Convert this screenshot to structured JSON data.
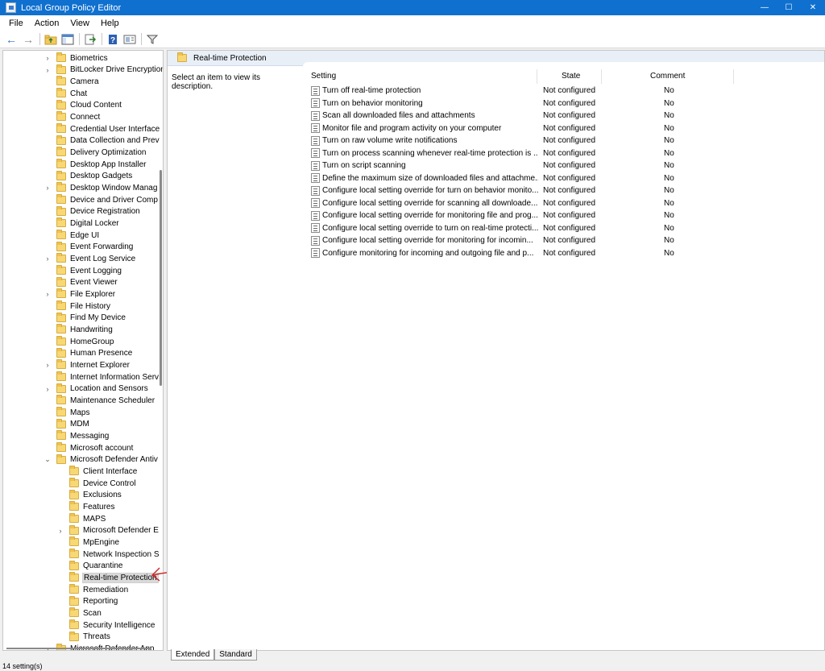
{
  "window": {
    "title": "Local Group Policy Editor",
    "min": "—",
    "max": "☐",
    "close": "✕"
  },
  "menu": [
    "File",
    "Action",
    "View",
    "Help"
  ],
  "tree": [
    {
      "label": "Biometrics",
      "expander": "›",
      "level": 1
    },
    {
      "label": "BitLocker Drive Encryption",
      "expander": "›",
      "level": 1
    },
    {
      "label": "Camera",
      "expander": "",
      "level": 1
    },
    {
      "label": "Chat",
      "expander": "",
      "level": 1
    },
    {
      "label": "Cloud Content",
      "expander": "",
      "level": 1
    },
    {
      "label": "Connect",
      "expander": "",
      "level": 1
    },
    {
      "label": "Credential User Interface",
      "expander": "",
      "level": 1
    },
    {
      "label": "Data Collection and Prev",
      "expander": "",
      "level": 1
    },
    {
      "label": "Delivery Optimization",
      "expander": "",
      "level": 1
    },
    {
      "label": "Desktop App Installer",
      "expander": "",
      "level": 1
    },
    {
      "label": "Desktop Gadgets",
      "expander": "",
      "level": 1
    },
    {
      "label": "Desktop Window Manag",
      "expander": "›",
      "level": 1
    },
    {
      "label": "Device and Driver Comp",
      "expander": "",
      "level": 1
    },
    {
      "label": "Device Registration",
      "expander": "",
      "level": 1
    },
    {
      "label": "Digital Locker",
      "expander": "",
      "level": 1
    },
    {
      "label": "Edge UI",
      "expander": "",
      "level": 1
    },
    {
      "label": "Event Forwarding",
      "expander": "",
      "level": 1
    },
    {
      "label": "Event Log Service",
      "expander": "›",
      "level": 1
    },
    {
      "label": "Event Logging",
      "expander": "",
      "level": 1
    },
    {
      "label": "Event Viewer",
      "expander": "",
      "level": 1
    },
    {
      "label": "File Explorer",
      "expander": "›",
      "level": 1
    },
    {
      "label": "File History",
      "expander": "",
      "level": 1
    },
    {
      "label": "Find My Device",
      "expander": "",
      "level": 1
    },
    {
      "label": "Handwriting",
      "expander": "",
      "level": 1
    },
    {
      "label": "HomeGroup",
      "expander": "",
      "level": 1
    },
    {
      "label": "Human Presence",
      "expander": "",
      "level": 1
    },
    {
      "label": "Internet Explorer",
      "expander": "›",
      "level": 1
    },
    {
      "label": "Internet Information Serv",
      "expander": "",
      "level": 1
    },
    {
      "label": "Location and Sensors",
      "expander": "›",
      "level": 1
    },
    {
      "label": "Maintenance Scheduler",
      "expander": "",
      "level": 1
    },
    {
      "label": "Maps",
      "expander": "",
      "level": 1
    },
    {
      "label": "MDM",
      "expander": "",
      "level": 1
    },
    {
      "label": "Messaging",
      "expander": "",
      "level": 1
    },
    {
      "label": "Microsoft account",
      "expander": "",
      "level": 1
    },
    {
      "label": "Microsoft Defender Antiv",
      "expander": "⌄",
      "level": 1
    },
    {
      "label": "Client Interface",
      "expander": "",
      "level": 2
    },
    {
      "label": "Device Control",
      "expander": "",
      "level": 2
    },
    {
      "label": "Exclusions",
      "expander": "",
      "level": 2
    },
    {
      "label": "Features",
      "expander": "",
      "level": 2
    },
    {
      "label": "MAPS",
      "expander": "",
      "level": 2
    },
    {
      "label": "Microsoft Defender E",
      "expander": "›",
      "level": 2
    },
    {
      "label": "MpEngine",
      "expander": "",
      "level": 2
    },
    {
      "label": "Network Inspection S",
      "expander": "",
      "level": 2
    },
    {
      "label": "Quarantine",
      "expander": "",
      "level": 2
    },
    {
      "label": "Real-time Protection",
      "expander": "",
      "level": 2,
      "selected": true
    },
    {
      "label": "Remediation",
      "expander": "",
      "level": 2
    },
    {
      "label": "Reporting",
      "expander": "",
      "level": 2
    },
    {
      "label": "Scan",
      "expander": "",
      "level": 2
    },
    {
      "label": "Security Intelligence",
      "expander": "",
      "level": 2
    },
    {
      "label": "Threats",
      "expander": "",
      "level": 2
    },
    {
      "label": "Microsoft Defender App",
      "expander": "›",
      "level": 1
    }
  ],
  "right": {
    "title": "Real-time Protection",
    "description": "Select an item to view its description.",
    "columns": {
      "setting": "Setting",
      "state": "State",
      "comment": "Comment"
    },
    "settings": [
      {
        "name": "Turn off real-time protection",
        "state": "Not configured",
        "comment": "No"
      },
      {
        "name": "Turn on behavior monitoring",
        "state": "Not configured",
        "comment": "No"
      },
      {
        "name": "Scan all downloaded files and attachments",
        "state": "Not configured",
        "comment": "No"
      },
      {
        "name": "Monitor file and program activity on your computer",
        "state": "Not configured",
        "comment": "No"
      },
      {
        "name": "Turn on raw volume write notifications",
        "state": "Not configured",
        "comment": "No"
      },
      {
        "name": "Turn on process scanning whenever real-time protection is ...",
        "state": "Not configured",
        "comment": "No"
      },
      {
        "name": "Turn on script scanning",
        "state": "Not configured",
        "comment": "No"
      },
      {
        "name": "Define the maximum size of downloaded files and attachme...",
        "state": "Not configured",
        "comment": "No"
      },
      {
        "name": "Configure local setting override for turn on behavior monito...",
        "state": "Not configured",
        "comment": "No"
      },
      {
        "name": "Configure local setting override for scanning all downloade...",
        "state": "Not configured",
        "comment": "No"
      },
      {
        "name": "Configure local setting override for monitoring file and prog...",
        "state": "Not configured",
        "comment": "No"
      },
      {
        "name": "Configure local setting override to turn on real-time protecti...",
        "state": "Not configured",
        "comment": "No"
      },
      {
        "name": "Configure local setting override for monitoring for incomin...",
        "state": "Not configured",
        "comment": "No"
      },
      {
        "name": "Configure monitoring for incoming and outgoing file and p...",
        "state": "Not configured",
        "comment": "No"
      }
    ],
    "tabs": [
      "Extended",
      "Standard"
    ]
  },
  "status": "14 setting(s)"
}
